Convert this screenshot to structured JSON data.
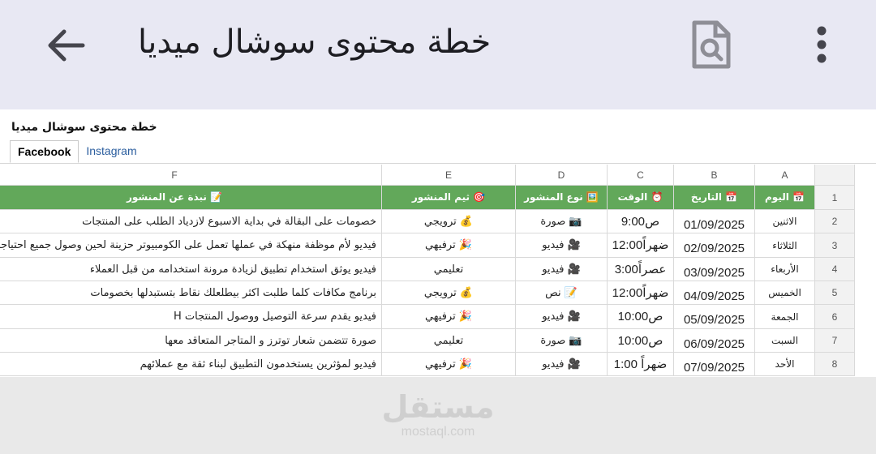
{
  "appbar": {
    "title": "خطة محتوى سوشال ميديا",
    "back_icon": "arrow-left-icon",
    "doc_icon": "document-search-icon",
    "more_icon": "more-vertical-icon"
  },
  "sheet": {
    "title": "خطة محتوى سوشال ميديا",
    "tabs": [
      {
        "label": "Facebook",
        "active": true
      },
      {
        "label": "Instagram",
        "active": false
      }
    ],
    "col_letters": [
      "A",
      "B",
      "C",
      "D",
      "E",
      "F"
    ],
    "row_numbers": [
      "1",
      "2",
      "3",
      "4",
      "5",
      "6",
      "7",
      "8"
    ],
    "headers": [
      "📅 اليوم",
      "📅 التاريخ",
      "⏰ الوقت",
      "🖼️ نوع المنشور",
      "🎯 ثيم المنشور",
      "📝 نبذة عن المنشور"
    ],
    "rows": [
      {
        "day": "الاثنين",
        "date": "01/09/2025",
        "time": "ص9:00",
        "type": "📷 صورة",
        "theme": "💰 ترويجي",
        "desc": "خصومات على البقالة في بداية الاسبوع لازدياد الطلب على المنتجات"
      },
      {
        "day": "الثلاثاء",
        "date": "02/09/2025",
        "time": "ضهراً12:00",
        "type": "🎥 فيديو",
        "theme": "🎉 ترفيهي",
        "desc": "فيديو لأم موظفة منهكة في عملها تعمل على الكومبيوتر حزينة لحين وصول جميع احتياجاتها"
      },
      {
        "day": "الأربعاء",
        "date": "03/09/2025",
        "time": "عصراً3:00",
        "type": "🎥 فيديو",
        "theme": "تعليمي",
        "desc": "فيديو يوثق استخدام تطبيق لزيادة مرونة استخدامه من قبل العملاء"
      },
      {
        "day": "الخميس",
        "date": "04/09/2025",
        "time": "ضهراً12:00",
        "type": "📝 نص",
        "theme": "💰 ترويجي",
        "desc": "برنامج مكافات كلما طلبت اكثر بيطلعلك نقاط بتستبدلها بخصومات"
      },
      {
        "day": "الجمعة",
        "date": "05/09/2025",
        "time": "ص10:00",
        "type": "🎥 فيديو",
        "theme": "🎉 ترفيهي",
        "desc": "فيديو يقدم سرعة التوصيل ووصول المنتجات H"
      },
      {
        "day": "السبت",
        "date": "06/09/2025",
        "time": "ص10:00",
        "type": "📷 صورة",
        "theme": "تعليمي",
        "desc": "صورة تتضمن شعار توترز و المتاجر المتعاقد معها"
      },
      {
        "day": "الأحد",
        "date": "07/09/2025",
        "time": "ضهراً 1:00",
        "type": "🎥 فيديو",
        "theme": "🎉 ترفيهي",
        "desc": "فيديو لمؤثرين يستخدمون التطبيق لبناء ثقة مع عملائهم"
      }
    ]
  },
  "watermark": {
    "logo": "مستقل",
    "url": "mostaql.com"
  }
}
